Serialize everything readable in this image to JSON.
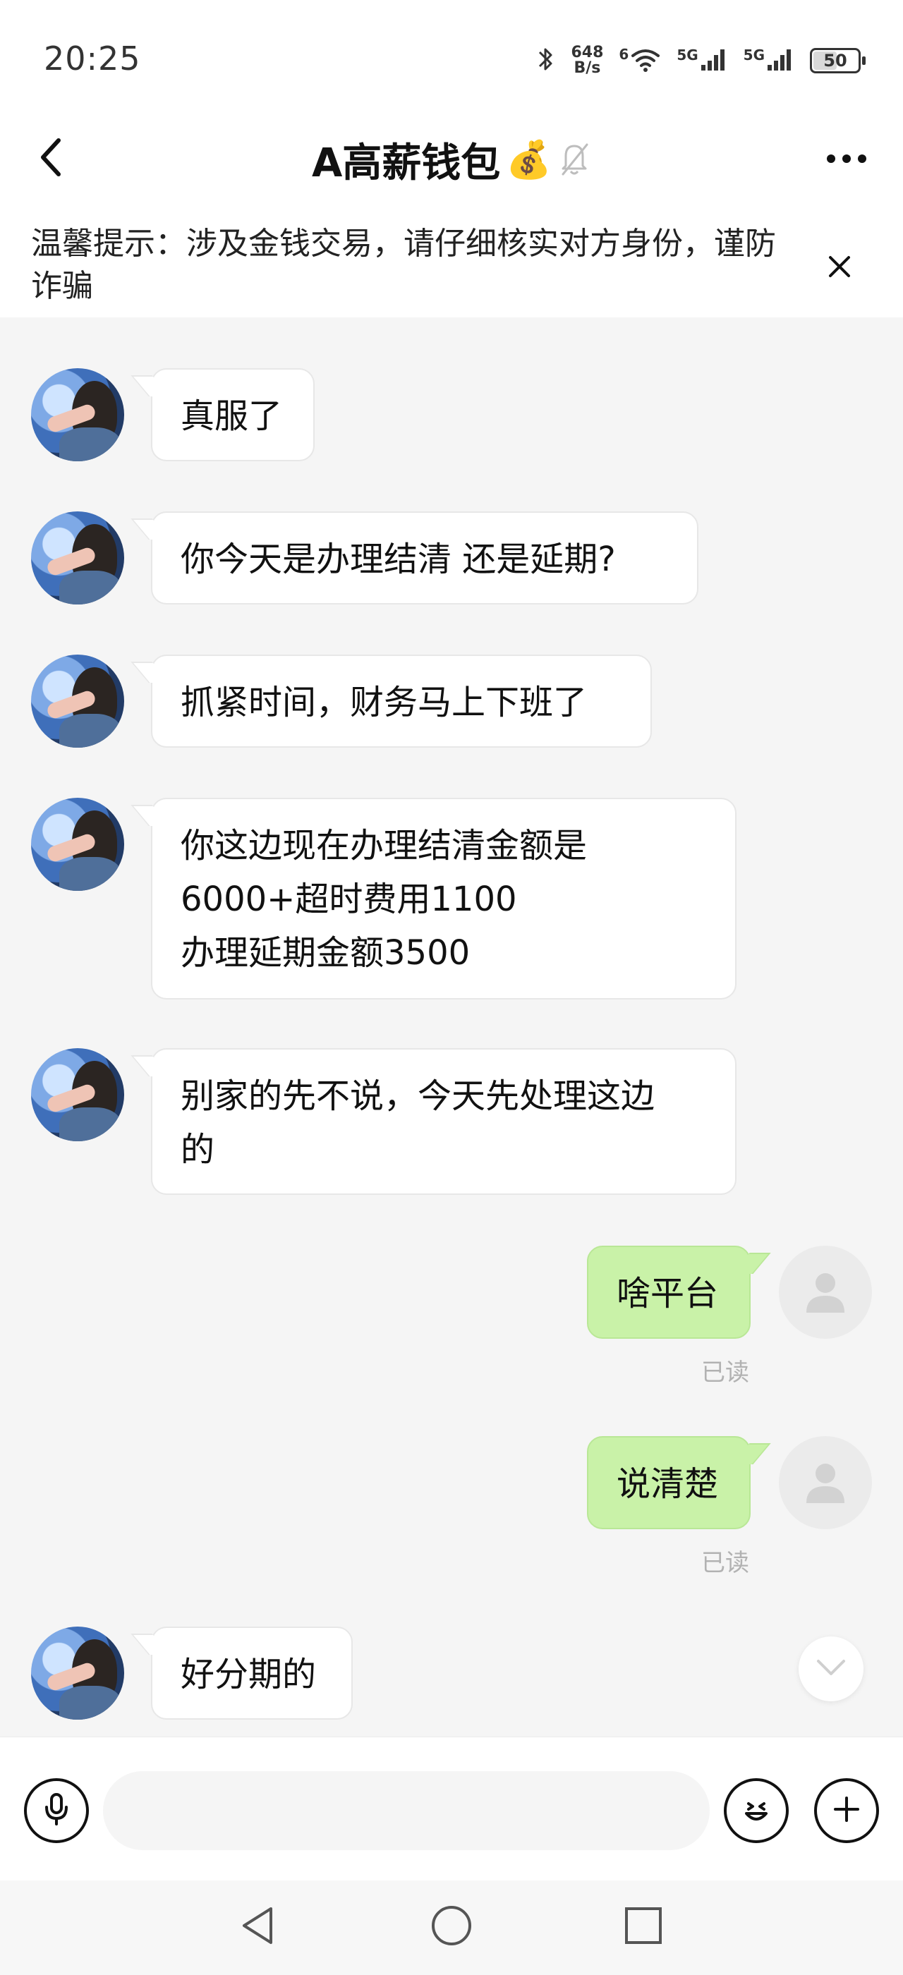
{
  "status_bar": {
    "time": "20:25",
    "net_speed_value": "648",
    "net_speed_unit": "B/s",
    "wifi_label": "6",
    "sim1_label": "5G",
    "sim2_label": "5G",
    "battery_level": "50"
  },
  "header": {
    "title": "A高薪钱包",
    "title_emoji": "💰"
  },
  "notice": {
    "text": "温馨提示：涉及金钱交易，请仔细核实对方身份，谨防诈骗"
  },
  "messages": [
    {
      "side": "left",
      "text": "真服了"
    },
    {
      "side": "left",
      "text": "你今天是办理结清 还是延期?"
    },
    {
      "side": "left",
      "text": "抓紧时间，财务马上下班了"
    },
    {
      "side": "left",
      "lines": [
        "你这边现在办理结清金额是",
        "6000+超时费用1100",
        "办理延期金额3500"
      ]
    },
    {
      "side": "left",
      "lines": [
        "别家的先不说，今天先处理这边",
        "的"
      ]
    },
    {
      "side": "right",
      "text": "啥平台",
      "status": "已读"
    },
    {
      "side": "right",
      "text": "说清楚",
      "status": "已读"
    },
    {
      "side": "left",
      "text": "好分期的"
    }
  ],
  "input": {
    "value": "",
    "placeholder": ""
  },
  "icons": {
    "back": "chevron-left-icon",
    "mute": "bell-off-icon",
    "more": "more-horizontal-icon",
    "close": "close-icon",
    "scroll_down": "chevron-down-icon",
    "voice": "microphone-icon",
    "emoji": "smile-icon",
    "add": "plus-icon",
    "nav_back": "triangle-back-icon",
    "nav_home": "circle-home-icon",
    "nav_recent": "square-recent-icon"
  },
  "colors": {
    "outgoing_bubble": "#c9f2a8",
    "incoming_bubble": "#ffffff",
    "background": "#f5f5f5",
    "read_status": "#b2b2b2"
  }
}
